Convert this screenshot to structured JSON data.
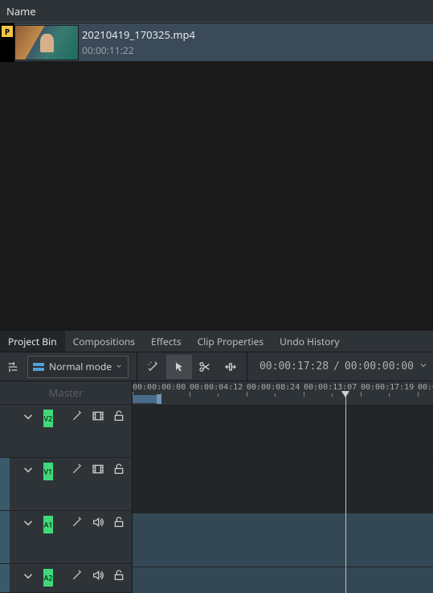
{
  "bin": {
    "header_label": "Name",
    "item": {
      "marker": "P",
      "filename": "20210419_170325.mp4",
      "duration": "00:00:11:22"
    }
  },
  "tabs": {
    "items": [
      "Project Bin",
      "Compositions",
      "Effects",
      "Clip Properties",
      "Undo History"
    ],
    "active": 0
  },
  "toolbar": {
    "mode_label": "Normal mode",
    "timecode_current": "00:00:17:28",
    "timecode_sep": "/",
    "timecode_total": "00:00:00:00"
  },
  "timeline": {
    "master_label": "Master",
    "ruler_ticks": [
      "00:00:00:00",
      "00:00:04:12",
      "00:00:08:24",
      "00:00:13:07",
      "00:00:17:19",
      "00:0"
    ],
    "tracks": [
      {
        "id": "V2",
        "type": "video"
      },
      {
        "id": "V1",
        "type": "video"
      },
      {
        "id": "A1",
        "type": "audio"
      },
      {
        "id": "A2",
        "type": "audio"
      }
    ]
  }
}
